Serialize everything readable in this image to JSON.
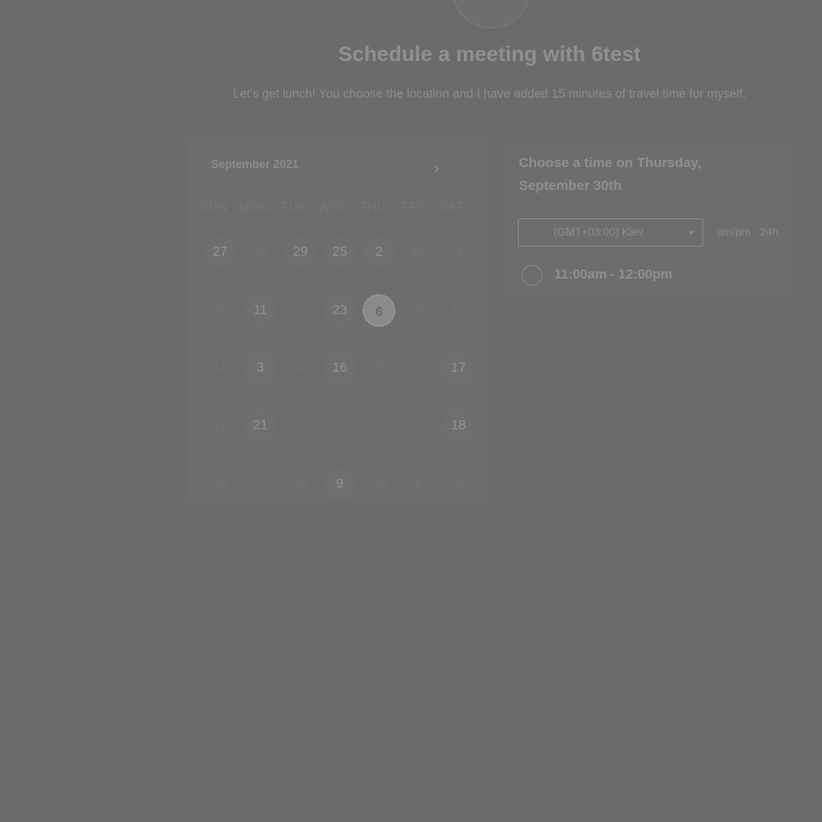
{
  "header": {
    "title": "Schedule a meeting with 6test",
    "description": "Let's get lunch! You choose the location and I have added 15 minutes of travel time for myself."
  },
  "calendar": {
    "month_label": "September 2021",
    "prev_icon": "chevron-left-icon",
    "next_icon": "chevron-right-icon",
    "prev_glyph": "‹",
    "next_glyph": "›",
    "weekdays": [
      "SUN",
      "MON",
      "TUE",
      "WED",
      "THU",
      "FRI",
      "SAT"
    ],
    "weeks": [
      [
        {
          "label": "27",
          "available": true
        },
        {
          "label": "28",
          "available": false
        },
        {
          "label": "29",
          "available": true
        },
        {
          "label": "25",
          "available": true
        },
        {
          "label": "2",
          "available": true
        },
        {
          "label": "12",
          "available": false
        },
        {
          "label": "3",
          "available": false
        }
      ],
      [
        {
          "label": "5",
          "available": false
        },
        {
          "label": "11",
          "available": true
        },
        {
          "label": "7",
          "available": false
        },
        {
          "label": "23",
          "available": true
        },
        {
          "label": "6",
          "available": true,
          "selected": true
        },
        {
          "label": "9",
          "available": false
        },
        {
          "label": "19",
          "available": false
        }
      ],
      [
        {
          "label": "12",
          "available": false
        },
        {
          "label": "3",
          "available": true
        },
        {
          "label": "4",
          "available": false
        },
        {
          "label": "16",
          "available": true
        },
        {
          "label": "5",
          "available": false
        },
        {
          "label": "7",
          "available": false
        },
        {
          "label": "17",
          "available": true
        }
      ],
      [
        {
          "label": "19",
          "available": false
        },
        {
          "label": "21",
          "available": true
        },
        {
          "label": "2",
          "available": false
        },
        {
          "label": "2",
          "available": false
        },
        {
          "label": "24",
          "available": false
        },
        {
          "label": "5",
          "available": false
        },
        {
          "label": "18",
          "available": true
        }
      ],
      [
        {
          "label": "26",
          "available": false
        },
        {
          "label": "7",
          "available": false
        },
        {
          "label": "28",
          "available": false
        },
        {
          "label": "9",
          "available": true
        },
        {
          "label": "30",
          "available": false
        },
        {
          "label": "1",
          "available": false
        },
        {
          "label": "2",
          "available": false
        }
      ]
    ]
  },
  "times": {
    "title": "Choose a time on Thursday, September 30th",
    "timezone": "(GMT+03:00) Kiev",
    "format_ampm": "am/pm",
    "format_24h": "24h",
    "slots": [
      "11:00am - 12:00pm"
    ]
  },
  "colors": {
    "overlay": "#6b6b6b",
    "text_primary": "#909090",
    "text_muted": "#737373"
  }
}
